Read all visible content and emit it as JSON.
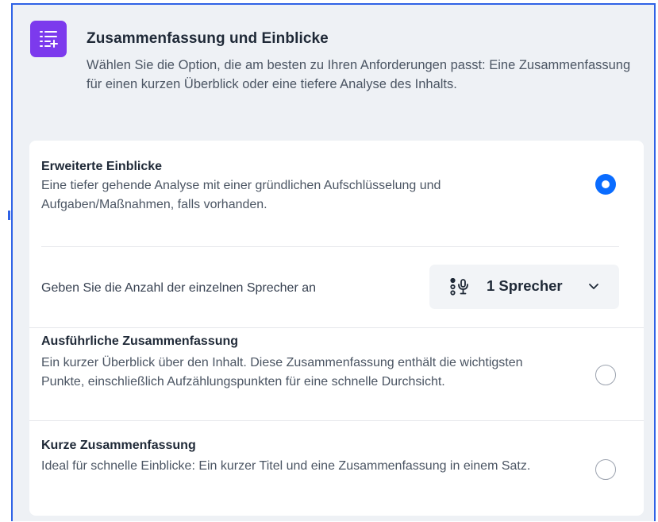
{
  "header": {
    "icon": "list-sparkle-icon",
    "title": "Zusammenfassung und Einblicke",
    "description": "Wählen Sie die Option, die am besten zu Ihren Anforderungen passt: Eine Zusammenfassung für einen kurzen Überblick oder eine tiefere Analyse des Inhalts."
  },
  "options": [
    {
      "title": "Erweiterte Einblicke",
      "description": "Eine tiefer gehende Analyse mit einer gründlichen Aufschlüsselung und Aufgaben/Maßnahmen, falls vorhanden.",
      "selected": true
    },
    {
      "title": "Ausführliche Zusammenfassung",
      "description": "Ein kurzer Überblick über den Inhalt. Diese Zusammenfassung enthält die wichtigsten Punkte, einschließlich Aufzählungspunkten für eine schnelle Durchsicht.",
      "selected": false
    },
    {
      "title": "Kurze Zusammenfassung",
      "description": "Ideal für schnelle Einblicke: Ein kurzer Titel und eine Zusammenfassung in einem Satz.",
      "selected": false
    }
  ],
  "speaker": {
    "label": "Geben Sie die Anzahl der einzelnen Sprecher an",
    "value": "1 Sprecher",
    "icon": "speaker-voice-icon"
  },
  "colors": {
    "accent": "#0a6cff",
    "icon_bg": "#7c3aed",
    "frame": "#2f62e6"
  }
}
